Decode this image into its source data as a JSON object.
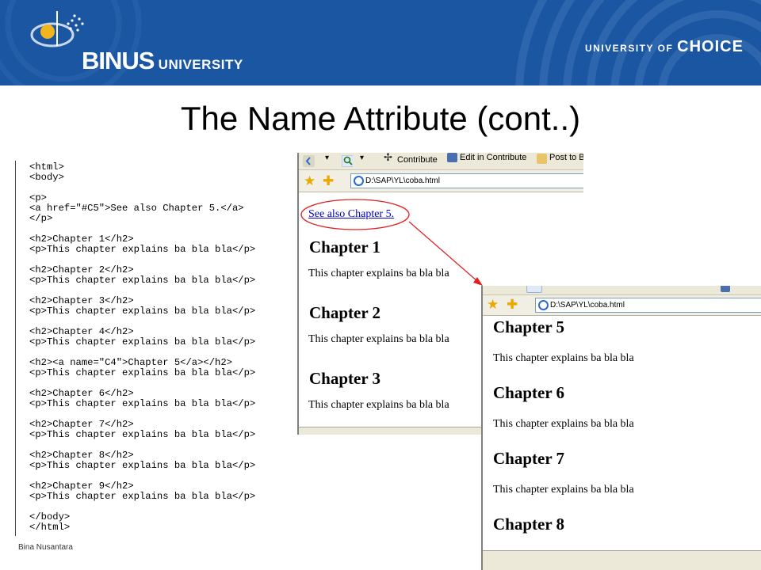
{
  "header": {
    "logo_big": "BINUS",
    "logo_small": " UNIVERSITY",
    "tagline_prefix": "UNIVERSITY OF ",
    "tagline_choice": "CHOICE",
    "banner_color": "#1a56a2"
  },
  "slide": {
    "title": "The Name Attribute (cont..)",
    "footer": "Bina Nusantara"
  },
  "code": {
    "lines": [
      "<html>",
      "<body>",
      "",
      "<p>",
      "<a href=\"#C5\">See also Chapter 5.</a>",
      "</p>",
      "",
      "<h2>Chapter 1</h2>",
      "<p>This chapter explains ba bla bla</p>",
      "",
      "<h2>Chapter 2</h2>",
      "<p>This chapter explains ba bla bla</p>",
      "",
      "<h2>Chapter 3</h2>",
      "<p>This chapter explains ba bla bla</p>",
      "",
      "<h2>Chapter 4</h2>",
      "<p>This chapter explains ba bla bla</p>",
      "",
      "<h2><a name=\"C4\">Chapter 5</a></h2>",
      "<p>This chapter explains ba bla bla</p>",
      "",
      "<h2>Chapter 6</h2>",
      "<p>This chapter explains ba bla bla</p>",
      "",
      "<h2>Chapter 7</h2>",
      "<p>This chapter explains ba bla bla</p>",
      "",
      "<h2>Chapter 8</h2>",
      "<p>This chapter explains ba bla bla</p>",
      "",
      "<h2>Chapter 9</h2>",
      "<p>This chapter explains ba bla bla</p>",
      "",
      "</body>",
      "</html>"
    ]
  },
  "browser1": {
    "toolbar": {
      "contribute": "Contribute",
      "edit_in_contribute": "Edit in Contribute",
      "post_to": "Post to B"
    },
    "address": "D:\\SAP\\YL\\coba.html",
    "link_text": "See also Chapter 5.",
    "chapters": [
      {
        "heading": "Chapter 1",
        "text": "This chapter explains ba bla bla"
      },
      {
        "heading": "Chapter 2",
        "text": "This chapter explains ba bla bla"
      },
      {
        "heading": "Chapter 3",
        "text": "This chapter explains ba bla bla"
      }
    ]
  },
  "browser2": {
    "address": "D:\\SAP\\YL\\coba.html",
    "chapters": [
      {
        "heading": "Chapter 5",
        "text": "This chapter explains ba bla bla"
      },
      {
        "heading": "Chapter 6",
        "text": "This chapter explains ba bla bla"
      },
      {
        "heading": "Chapter 7",
        "text": "This chapter explains ba bla bla"
      },
      {
        "heading": "Chapter 8",
        "text": ""
      }
    ]
  },
  "annotation": {
    "ellipse_color": "#e02020",
    "arrow_color": "#e02020"
  },
  "icons": {
    "favorites": "star-icon",
    "add_favorite": "add-favorite-icon",
    "page": "ie-page-icon",
    "search": "search-icon",
    "back": "back-icon"
  }
}
